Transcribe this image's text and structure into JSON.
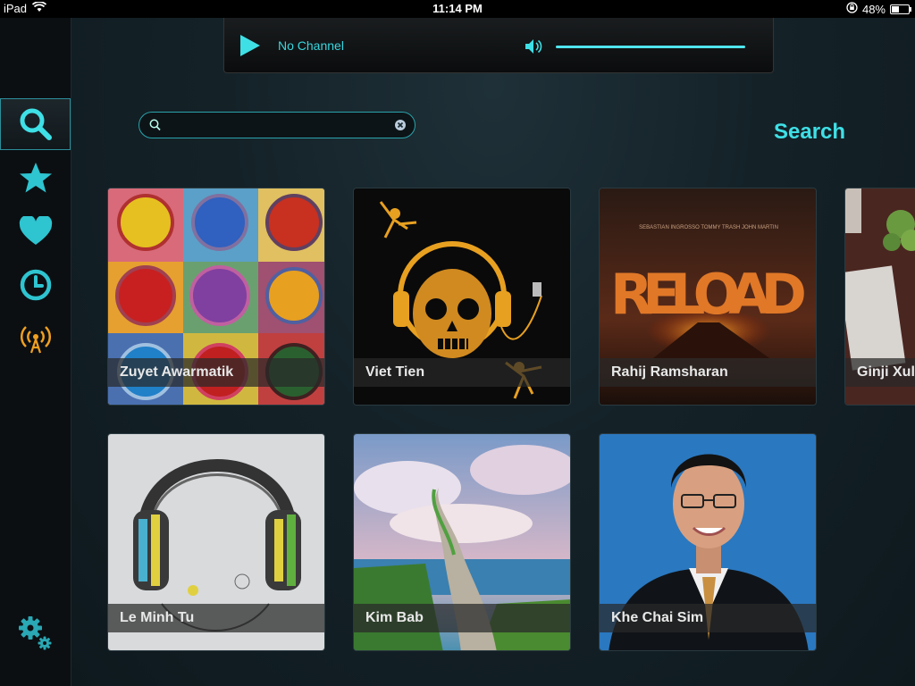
{
  "statusbar": {
    "device": "iPad",
    "time": "11:14 PM",
    "battery": "48%",
    "battery_level": 0.48
  },
  "player": {
    "play_icon": "play-icon",
    "channel": "No Channel",
    "volume_icon": "speaker-icon",
    "volume_level": 1.0
  },
  "sidebar": {
    "items": [
      {
        "name": "search",
        "icon": "search-icon",
        "active": true
      },
      {
        "name": "favorites",
        "icon": "star-icon"
      },
      {
        "name": "loved",
        "icon": "heart-icon"
      },
      {
        "name": "history",
        "icon": "clock-icon"
      },
      {
        "name": "broadcast",
        "icon": "broadcast-icon"
      }
    ],
    "settings_icon": "gear-icon"
  },
  "search": {
    "value": "",
    "placeholder": "",
    "button_label": "Search"
  },
  "colors": {
    "accent": "#3ee0e6",
    "broadcast": "#f0a020"
  },
  "results": [
    {
      "name": "Zuyet Awarmatik"
    },
    {
      "name": "Viet Tien"
    },
    {
      "name": "Rahij Ramsharan"
    },
    {
      "name": "Ginji Xul"
    },
    {
      "name": "Le Minh Tu"
    },
    {
      "name": "Kim Bab"
    },
    {
      "name": "Khe Chai Sim"
    }
  ],
  "art_text": {
    "reload_artists": "SEBASTIAN INGROSSO   TOMMY TRASH   JOHN MARTIN",
    "reload_title": "RELOAD"
  }
}
